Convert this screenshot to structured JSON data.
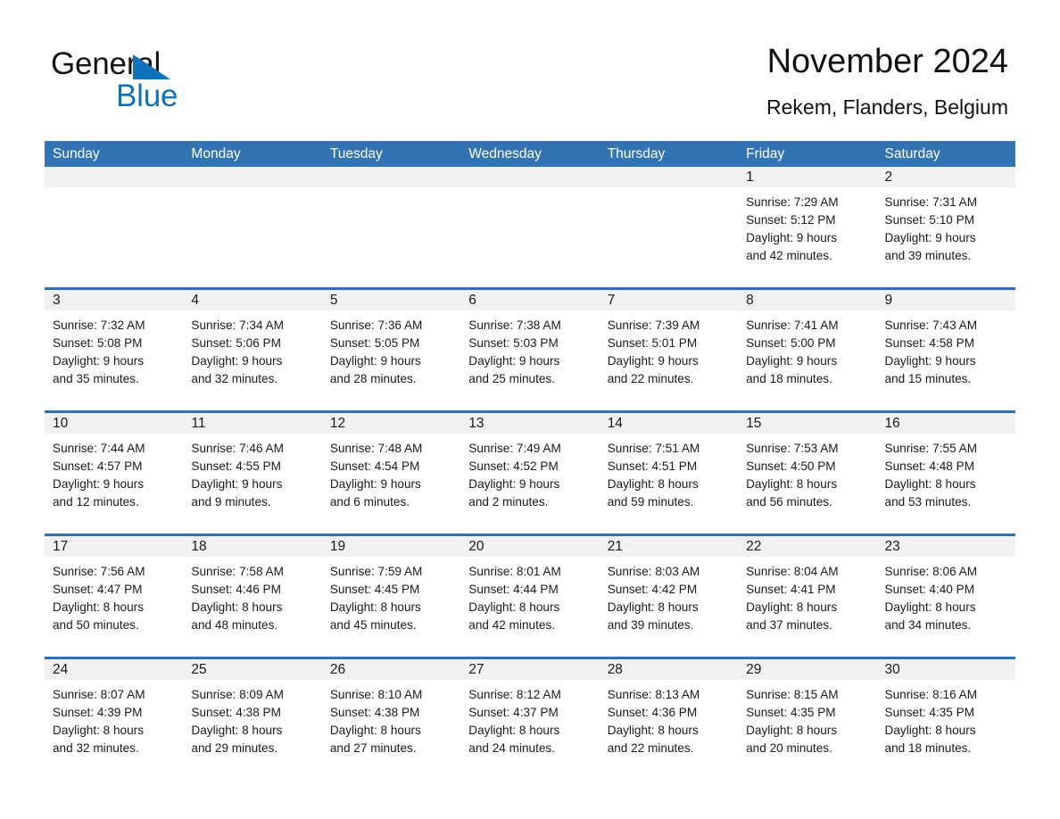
{
  "brand": {
    "name_part1": "General",
    "name_part2": "Blue",
    "triangle_icon": "triangle-logo-icon",
    "brand_color": "#1072ba"
  },
  "header": {
    "title": "November 2024",
    "subtitle": "Rekem, Flanders, Belgium"
  },
  "calendar": {
    "header_bg": "#3273b3",
    "week_rule_color": "#2e71b0",
    "daynum_band_bg": "#f1f1f1",
    "weekdays": [
      "Sunday",
      "Monday",
      "Tuesday",
      "Wednesday",
      "Thursday",
      "Friday",
      "Saturday"
    ],
    "weeks": [
      [
        {
          "day": "",
          "sunrise": "",
          "sunset": "",
          "daylight_line1": "",
          "daylight_line2": ""
        },
        {
          "day": "",
          "sunrise": "",
          "sunset": "",
          "daylight_line1": "",
          "daylight_line2": ""
        },
        {
          "day": "",
          "sunrise": "",
          "sunset": "",
          "daylight_line1": "",
          "daylight_line2": ""
        },
        {
          "day": "",
          "sunrise": "",
          "sunset": "",
          "daylight_line1": "",
          "daylight_line2": ""
        },
        {
          "day": "",
          "sunrise": "",
          "sunset": "",
          "daylight_line1": "",
          "daylight_line2": ""
        },
        {
          "day": "1",
          "sunrise": "Sunrise: 7:29 AM",
          "sunset": "Sunset: 5:12 PM",
          "daylight_line1": "Daylight: 9 hours",
          "daylight_line2": "and 42 minutes."
        },
        {
          "day": "2",
          "sunrise": "Sunrise: 7:31 AM",
          "sunset": "Sunset: 5:10 PM",
          "daylight_line1": "Daylight: 9 hours",
          "daylight_line2": "and 39 minutes."
        }
      ],
      [
        {
          "day": "3",
          "sunrise": "Sunrise: 7:32 AM",
          "sunset": "Sunset: 5:08 PM",
          "daylight_line1": "Daylight: 9 hours",
          "daylight_line2": "and 35 minutes."
        },
        {
          "day": "4",
          "sunrise": "Sunrise: 7:34 AM",
          "sunset": "Sunset: 5:06 PM",
          "daylight_line1": "Daylight: 9 hours",
          "daylight_line2": "and 32 minutes."
        },
        {
          "day": "5",
          "sunrise": "Sunrise: 7:36 AM",
          "sunset": "Sunset: 5:05 PM",
          "daylight_line1": "Daylight: 9 hours",
          "daylight_line2": "and 28 minutes."
        },
        {
          "day": "6",
          "sunrise": "Sunrise: 7:38 AM",
          "sunset": "Sunset: 5:03 PM",
          "daylight_line1": "Daylight: 9 hours",
          "daylight_line2": "and 25 minutes."
        },
        {
          "day": "7",
          "sunrise": "Sunrise: 7:39 AM",
          "sunset": "Sunset: 5:01 PM",
          "daylight_line1": "Daylight: 9 hours",
          "daylight_line2": "and 22 minutes."
        },
        {
          "day": "8",
          "sunrise": "Sunrise: 7:41 AM",
          "sunset": "Sunset: 5:00 PM",
          "daylight_line1": "Daylight: 9 hours",
          "daylight_line2": "and 18 minutes."
        },
        {
          "day": "9",
          "sunrise": "Sunrise: 7:43 AM",
          "sunset": "Sunset: 4:58 PM",
          "daylight_line1": "Daylight: 9 hours",
          "daylight_line2": "and 15 minutes."
        }
      ],
      [
        {
          "day": "10",
          "sunrise": "Sunrise: 7:44 AM",
          "sunset": "Sunset: 4:57 PM",
          "daylight_line1": "Daylight: 9 hours",
          "daylight_line2": "and 12 minutes."
        },
        {
          "day": "11",
          "sunrise": "Sunrise: 7:46 AM",
          "sunset": "Sunset: 4:55 PM",
          "daylight_line1": "Daylight: 9 hours",
          "daylight_line2": "and 9 minutes."
        },
        {
          "day": "12",
          "sunrise": "Sunrise: 7:48 AM",
          "sunset": "Sunset: 4:54 PM",
          "daylight_line1": "Daylight: 9 hours",
          "daylight_line2": "and 6 minutes."
        },
        {
          "day": "13",
          "sunrise": "Sunrise: 7:49 AM",
          "sunset": "Sunset: 4:52 PM",
          "daylight_line1": "Daylight: 9 hours",
          "daylight_line2": "and 2 minutes."
        },
        {
          "day": "14",
          "sunrise": "Sunrise: 7:51 AM",
          "sunset": "Sunset: 4:51 PM",
          "daylight_line1": "Daylight: 8 hours",
          "daylight_line2": "and 59 minutes."
        },
        {
          "day": "15",
          "sunrise": "Sunrise: 7:53 AM",
          "sunset": "Sunset: 4:50 PM",
          "daylight_line1": "Daylight: 8 hours",
          "daylight_line2": "and 56 minutes."
        },
        {
          "day": "16",
          "sunrise": "Sunrise: 7:55 AM",
          "sunset": "Sunset: 4:48 PM",
          "daylight_line1": "Daylight: 8 hours",
          "daylight_line2": "and 53 minutes."
        }
      ],
      [
        {
          "day": "17",
          "sunrise": "Sunrise: 7:56 AM",
          "sunset": "Sunset: 4:47 PM",
          "daylight_line1": "Daylight: 8 hours",
          "daylight_line2": "and 50 minutes."
        },
        {
          "day": "18",
          "sunrise": "Sunrise: 7:58 AM",
          "sunset": "Sunset: 4:46 PM",
          "daylight_line1": "Daylight: 8 hours",
          "daylight_line2": "and 48 minutes."
        },
        {
          "day": "19",
          "sunrise": "Sunrise: 7:59 AM",
          "sunset": "Sunset: 4:45 PM",
          "daylight_line1": "Daylight: 8 hours",
          "daylight_line2": "and 45 minutes."
        },
        {
          "day": "20",
          "sunrise": "Sunrise: 8:01 AM",
          "sunset": "Sunset: 4:44 PM",
          "daylight_line1": "Daylight: 8 hours",
          "daylight_line2": "and 42 minutes."
        },
        {
          "day": "21",
          "sunrise": "Sunrise: 8:03 AM",
          "sunset": "Sunset: 4:42 PM",
          "daylight_line1": "Daylight: 8 hours",
          "daylight_line2": "and 39 minutes."
        },
        {
          "day": "22",
          "sunrise": "Sunrise: 8:04 AM",
          "sunset": "Sunset: 4:41 PM",
          "daylight_line1": "Daylight: 8 hours",
          "daylight_line2": "and 37 minutes."
        },
        {
          "day": "23",
          "sunrise": "Sunrise: 8:06 AM",
          "sunset": "Sunset: 4:40 PM",
          "daylight_line1": "Daylight: 8 hours",
          "daylight_line2": "and 34 minutes."
        }
      ],
      [
        {
          "day": "24",
          "sunrise": "Sunrise: 8:07 AM",
          "sunset": "Sunset: 4:39 PM",
          "daylight_line1": "Daylight: 8 hours",
          "daylight_line2": "and 32 minutes."
        },
        {
          "day": "25",
          "sunrise": "Sunrise: 8:09 AM",
          "sunset": "Sunset: 4:38 PM",
          "daylight_line1": "Daylight: 8 hours",
          "daylight_line2": "and 29 minutes."
        },
        {
          "day": "26",
          "sunrise": "Sunrise: 8:10 AM",
          "sunset": "Sunset: 4:38 PM",
          "daylight_line1": "Daylight: 8 hours",
          "daylight_line2": "and 27 minutes."
        },
        {
          "day": "27",
          "sunrise": "Sunrise: 8:12 AM",
          "sunset": "Sunset: 4:37 PM",
          "daylight_line1": "Daylight: 8 hours",
          "daylight_line2": "and 24 minutes."
        },
        {
          "day": "28",
          "sunrise": "Sunrise: 8:13 AM",
          "sunset": "Sunset: 4:36 PM",
          "daylight_line1": "Daylight: 8 hours",
          "daylight_line2": "and 22 minutes."
        },
        {
          "day": "29",
          "sunrise": "Sunrise: 8:15 AM",
          "sunset": "Sunset: 4:35 PM",
          "daylight_line1": "Daylight: 8 hours",
          "daylight_line2": "and 20 minutes."
        },
        {
          "day": "30",
          "sunrise": "Sunrise: 8:16 AM",
          "sunset": "Sunset: 4:35 PM",
          "daylight_line1": "Daylight: 8 hours",
          "daylight_line2": "and 18 minutes."
        }
      ]
    ]
  }
}
